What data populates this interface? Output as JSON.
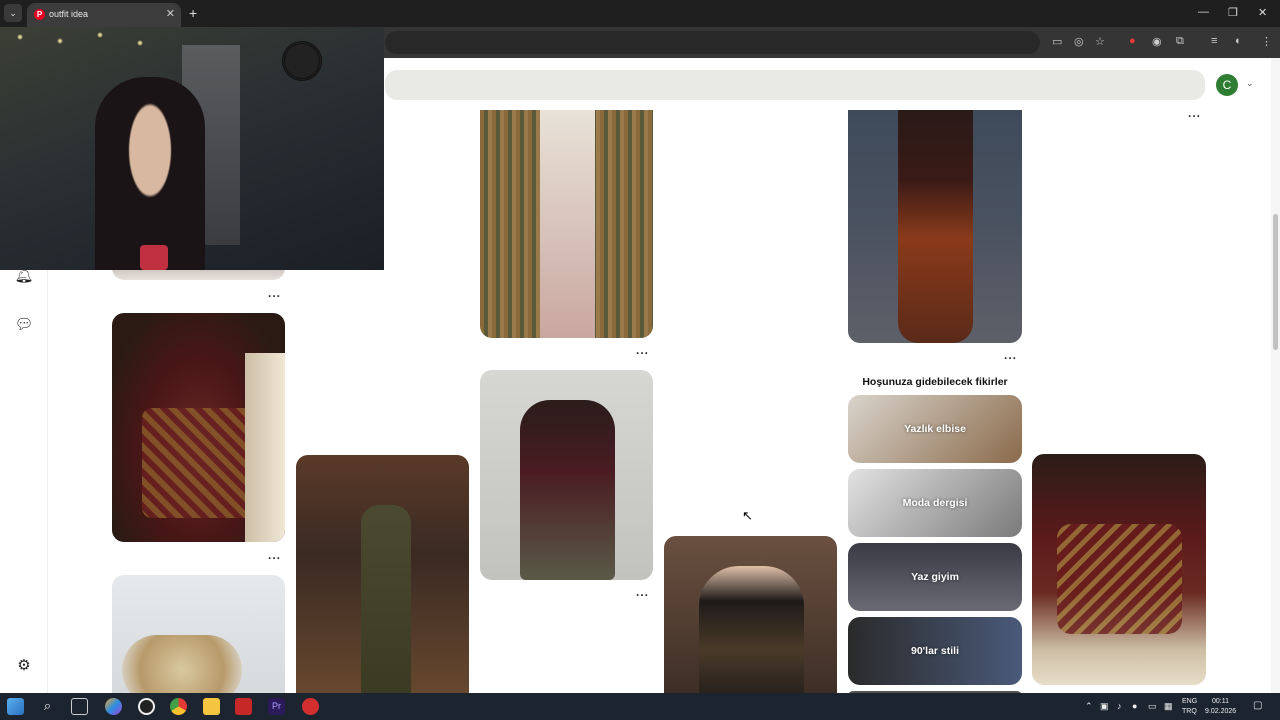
{
  "browser": {
    "tab_title": "outfit idea",
    "tab_close": "✕",
    "new_tab": "+",
    "menu_icon": "chevron-down-icon",
    "window_controls": [
      "—",
      "❐",
      "✕"
    ]
  },
  "header": {
    "avatar_letter": "C"
  },
  "pins": {
    "more_label": "..."
  },
  "ideas": {
    "title": "Hoşunuza gidebilecek fikirler",
    "items": [
      {
        "label": "Yazlık elbise",
        "color": "#a89a84"
      },
      {
        "label": "Moda dergisi",
        "color": "#8f8f8f"
      },
      {
        "label": "Yaz giyim",
        "color": "#4a4a52"
      },
      {
        "label": "90'lar stili",
        "color": "#3f4654"
      }
    ]
  },
  "taskbar": {
    "lang_line1": "ENG",
    "lang_line2": "TRQ",
    "time": "00:11",
    "date": "9.02.2026"
  },
  "colors": {
    "brand": "#e60023",
    "avatar": "#2e7d32",
    "chrome_dark": "#1f1f1f"
  }
}
